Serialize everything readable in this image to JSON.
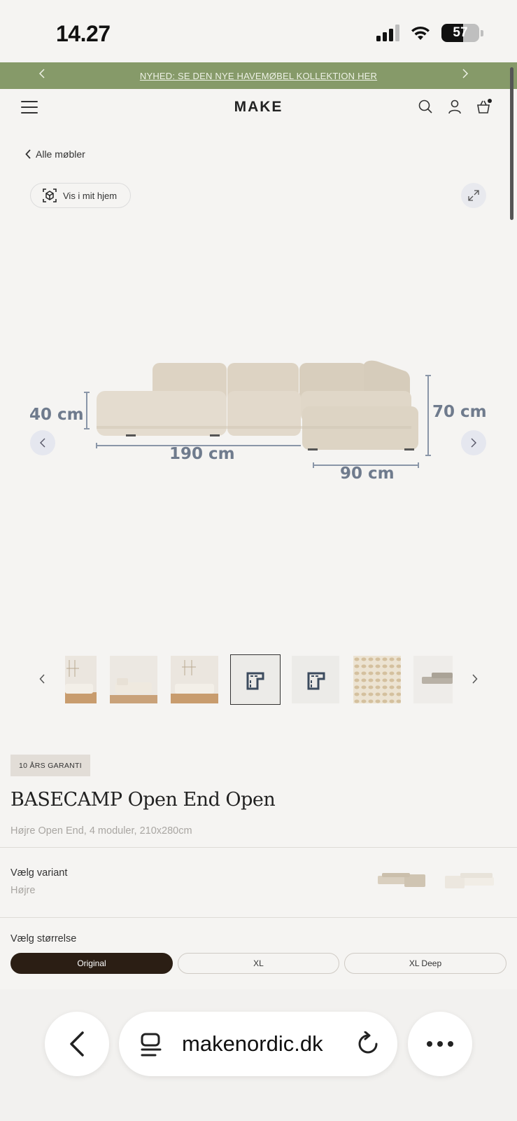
{
  "status_bar": {
    "time": "14.27",
    "battery": "57"
  },
  "promo": {
    "text": "NYHED: SE DEN NYE HAVEMØBEL KOLLEKTION HER"
  },
  "header": {
    "logo": "MAKE"
  },
  "nav": {
    "back_label": "Alle møbler",
    "ar_button_label": "Vis i mit hjem"
  },
  "hero": {
    "dimensions": {
      "depth_left": "40 cm",
      "length": "190 cm",
      "height": "70 cm",
      "depth_right": "90 cm"
    }
  },
  "thumbnails": {
    "items": [
      "room-photo-partial",
      "chaise-photo",
      "room-photo",
      "diagram-outline-selected",
      "diagram-outline",
      "fabric-swatch",
      "sofa-side-partial"
    ],
    "selected_index": 3
  },
  "product": {
    "badge": "10 ÅRS GARANTI",
    "title": "BASECAMP Open End Open",
    "subtitle": "Højre Open End, 4 moduler, 210x280cm"
  },
  "variant": {
    "label": "Vælg variant",
    "value": "Højre"
  },
  "size": {
    "label": "Vælg størrelse",
    "options": [
      "Original",
      "XL",
      "XL Deep"
    ],
    "selected": "Original"
  },
  "browser": {
    "url": "makenordic.dk"
  },
  "colors": {
    "promo_green": "#869a69",
    "selected_pill": "#2b1e14",
    "background": "#f5f4f2"
  }
}
